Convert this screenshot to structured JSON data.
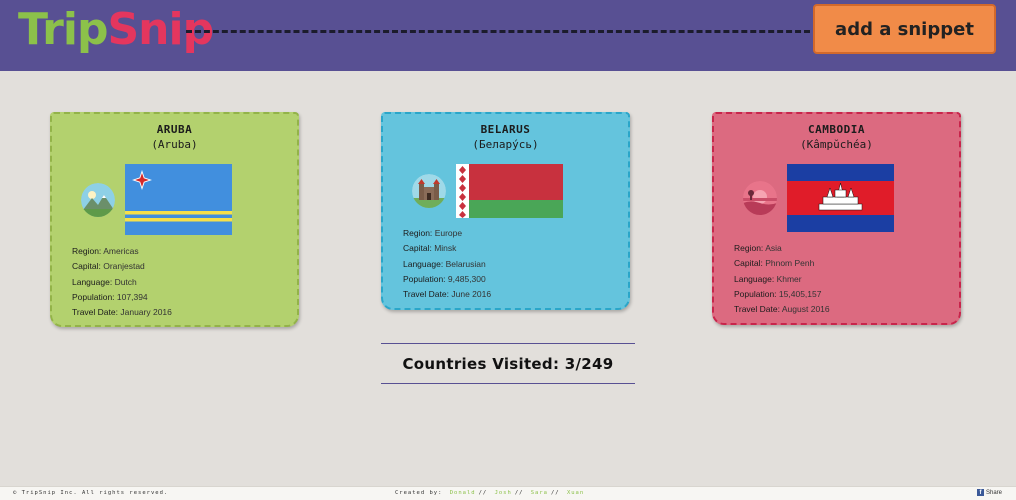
{
  "header": {
    "logo_trip": "Trip",
    "logo_snip": "Snip",
    "add_button": "add a snippet"
  },
  "labels": {
    "region": "Region:",
    "capital": "Capital:",
    "language": "Language:",
    "population": "Population:",
    "travel_date": "Travel Date:"
  },
  "cards": [
    {
      "name": "ARUBA",
      "native": "(Aruba)",
      "region": "Americas",
      "capital": "Oranjestad",
      "language": "Dutch",
      "population": "107,394",
      "travel_date": "January 2016",
      "flag_icon": "aruba-flag",
      "avatar_icon": "mountain-landscape-icon"
    },
    {
      "name": "BELARUS",
      "native": "(Белару́сь)",
      "region": "Europe",
      "capital": "Minsk",
      "language": "Belarusian",
      "population": "9,485,300",
      "travel_date": "June 2016",
      "flag_icon": "belarus-flag",
      "avatar_icon": "castle-icon"
    },
    {
      "name": "CAMBODIA",
      "native": "(Kâmpŭchéa)",
      "region": "Asia",
      "capital": "Phnom Penh",
      "language": "Khmer",
      "population": "15,405,157",
      "travel_date": "August 2016",
      "flag_icon": "cambodia-flag",
      "avatar_icon": "sunset-landscape-icon"
    }
  ],
  "counter": {
    "text": "Countries Visited: 3/249"
  },
  "footer": {
    "copyright": "© TripSnip Inc. All rights reserved.",
    "created_by": "Created by:",
    "names": [
      "Donald",
      "Josh",
      "Sara",
      "Xuan"
    ],
    "separator": "//",
    "share": "Share"
  },
  "colors": {
    "header_bg": "#585093",
    "logo_trip": "#8cc14a",
    "logo_snip": "#e4365e",
    "button_bg": "#f18b48",
    "aruba_card": "#b3d16e",
    "belarus_card": "#64c4dd",
    "cambodia_card": "#dc6a80",
    "page_bg": "#e2dfdb"
  }
}
